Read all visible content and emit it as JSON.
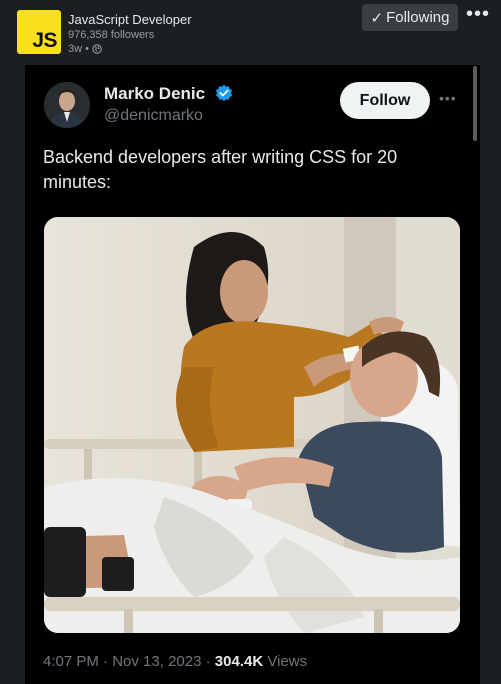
{
  "post": {
    "page_name": "JavaScript Developer",
    "logo_text": "JS",
    "followers": "976,358 followers",
    "age": "3w •",
    "visibility_icon": "globe-icon",
    "following_label": "Following",
    "following_icon": "checkmark-icon",
    "more_icon": "more-horizontal-icon",
    "logo_color": "#f7df1e"
  },
  "tweet": {
    "author_name": "Marko Denic",
    "handle": "@denicmarko",
    "verified_icon": "verified-badge-icon",
    "follow_label": "Follow",
    "text": "Backend developers after writing CSS for 20 minutes:",
    "time": "4:07 PM",
    "date": "Nov 13, 2023",
    "views_count": "304.4K",
    "views_label": "Views",
    "verified_color": "#1d9bf0"
  }
}
